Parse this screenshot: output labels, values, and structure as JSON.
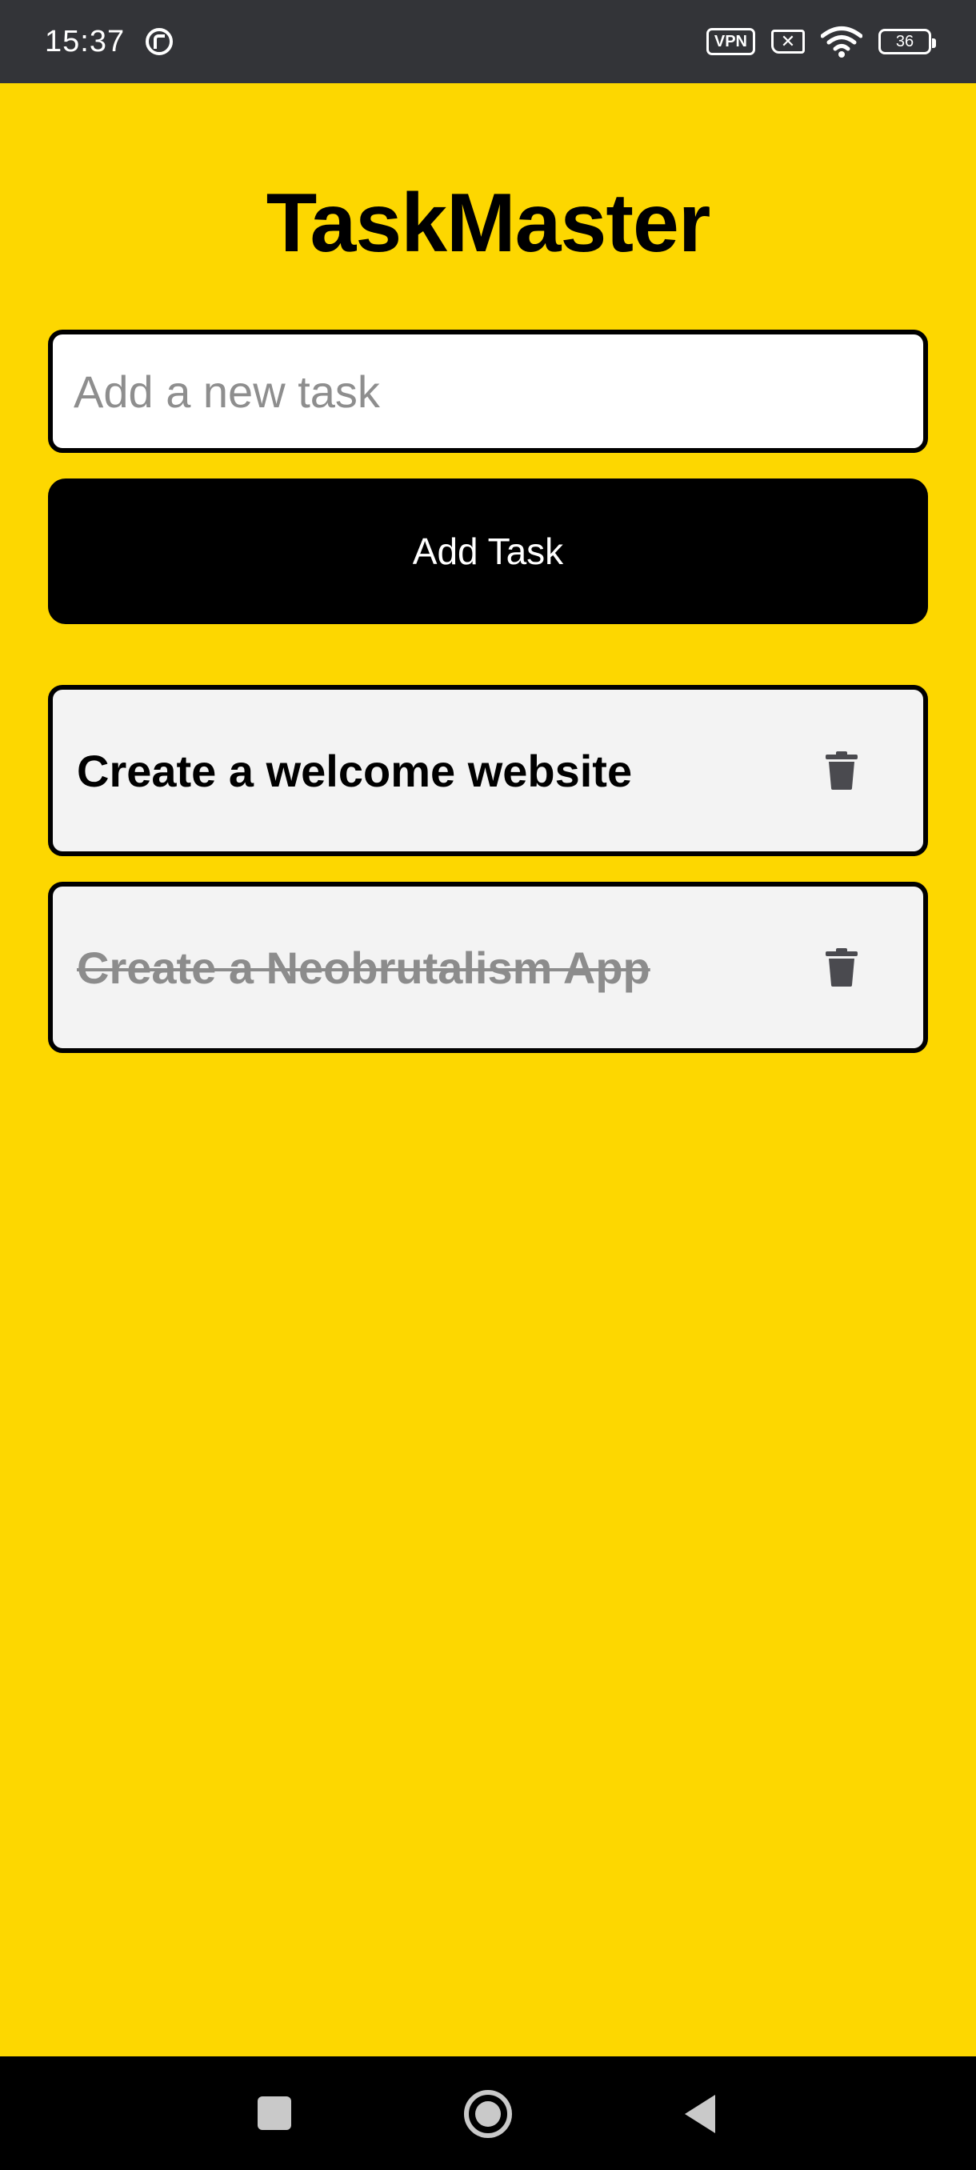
{
  "status_bar": {
    "time": "15:37",
    "vpn_label": "VPN",
    "battery_level": "36",
    "icons": [
      "app-notification-icon",
      "vpn-icon",
      "sim-disabled-icon",
      "wifi-icon",
      "battery-icon"
    ]
  },
  "app": {
    "title": "TaskMaster"
  },
  "input": {
    "placeholder": "Add a new task",
    "value": ""
  },
  "add_button": {
    "label": "Add Task"
  },
  "tasks": [
    {
      "text": "Create a welcome website",
      "completed": false
    },
    {
      "text": "Create a Neobrutalism App",
      "completed": true
    }
  ],
  "colors": {
    "background": "#FDD700",
    "card": "#F3F3F3",
    "button": "#000000",
    "completed_text": "#8C8C8C",
    "trash_icon": "#4A4A4F"
  },
  "nav_bar": {
    "icons": [
      "recents-icon",
      "home-icon",
      "back-icon"
    ]
  }
}
